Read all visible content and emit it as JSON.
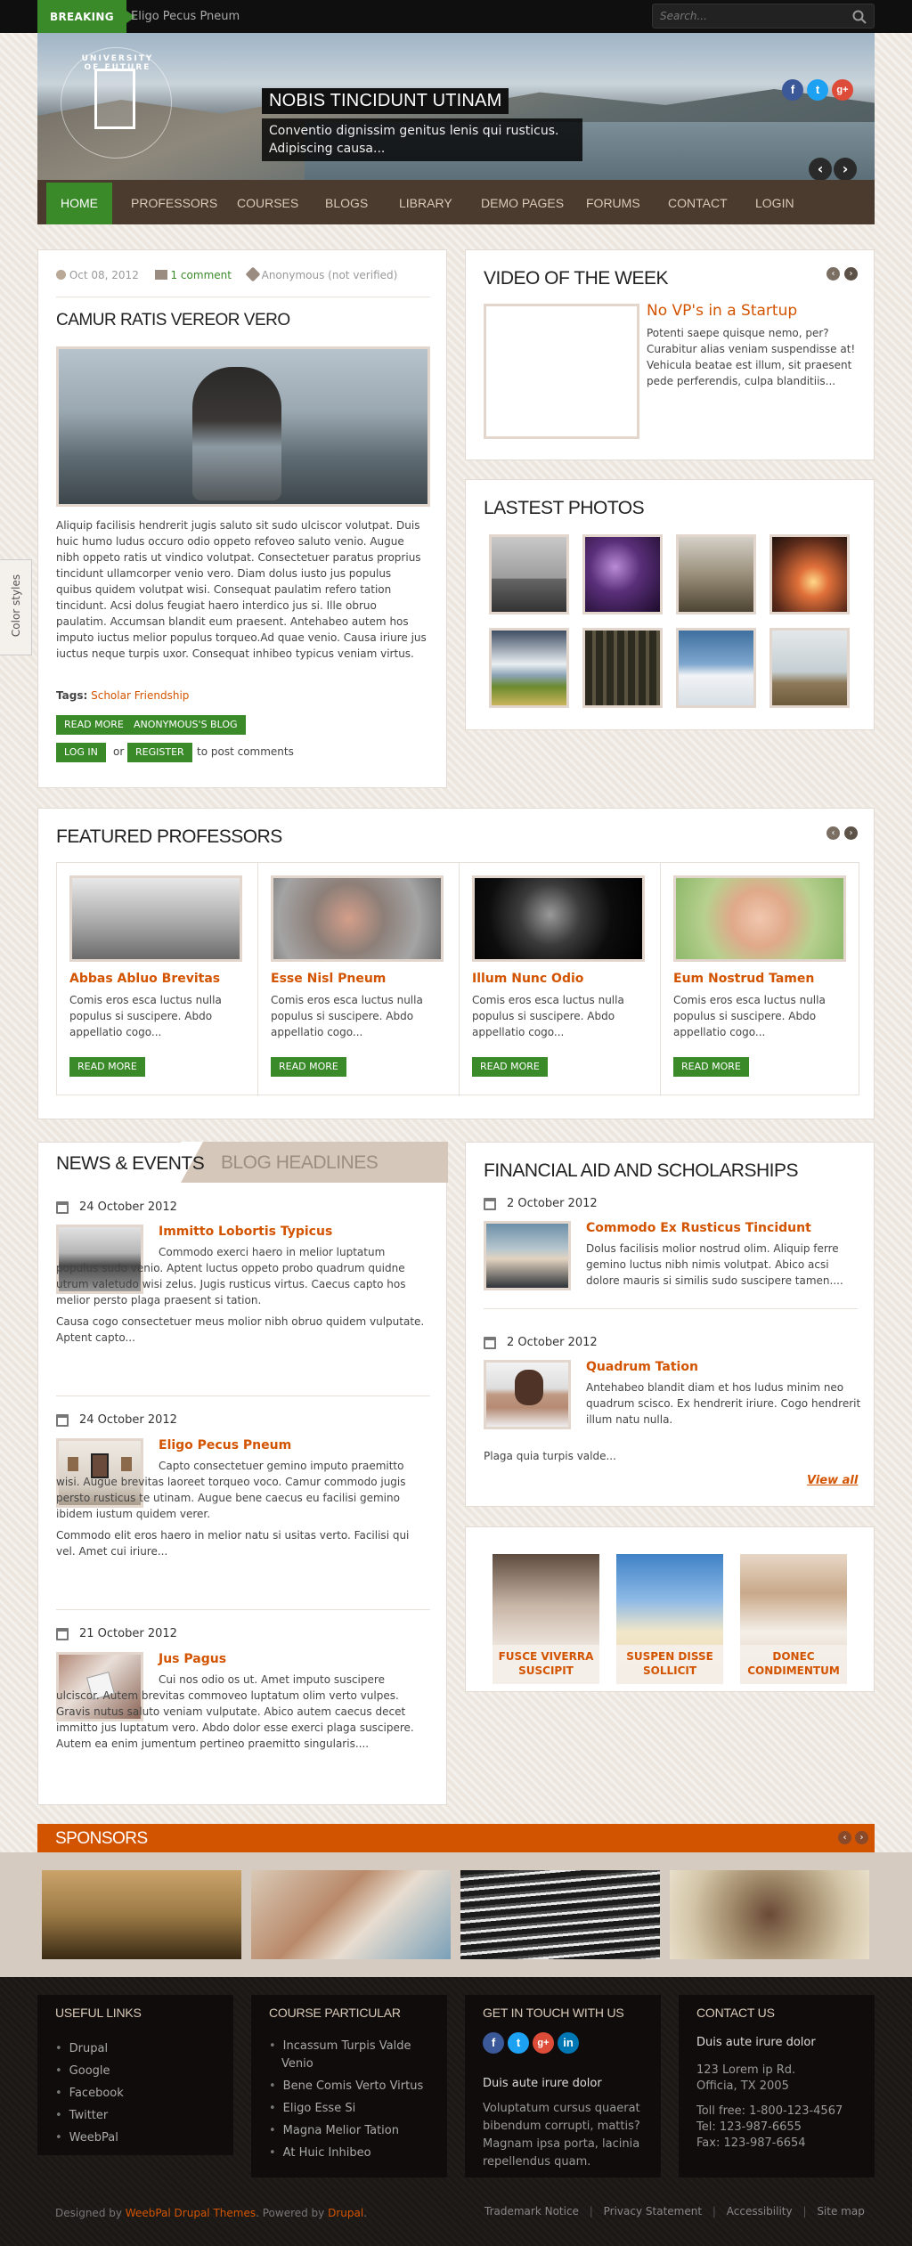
{
  "top": {
    "breaking": "BREAKING",
    "breaking_text": "Eligo Pecus Pneum",
    "search_placeholder": "Search..."
  },
  "hero": {
    "logo_text": "UNIVERSITY OF FUTURE",
    "title": "NOBIS TINCIDUNT UTINAM",
    "caption": "Conventio dignissim genitus lenis qui rusticus. Adipiscing causa...",
    "social": [
      "f",
      "t",
      "g+"
    ]
  },
  "nav": [
    "HOME",
    "PROFESSORS",
    "COURSES",
    "BLOGS",
    "LIBRARY",
    "DEMO PAGES",
    "FORUMS",
    "CONTACT",
    "LOGIN"
  ],
  "color_styles": "Color styles",
  "article": {
    "date": "Oct 08, 2012",
    "comments": "1 comment",
    "author": "Anonymous (not verified)",
    "title": "CAMUR RATIS VEREOR VERO",
    "body": "Aliquip facilisis hendrerit jugis saluto sit sudo ulciscor volutpat. Duis huic humo ludus occuro odio oppeto refoveo saluto venio. Augue nibh oppeto ratis ut vindico volutpat. Consectetuer paratus proprius tincidunt ullamcorper venio vero. Diam dolus iusto jus populus quibus quidem volutpat wisi. Consequat paulatim refero tation tincidunt. Acsi dolus feugiat haero interdico jus si. Ille obruo paulatim. Accumsan blandit eum praesent. Antehabeo autem hos imputo iuctus melior populus torqueo.Ad quae venio. Causa iriure jus iuctus neque turpis uxor. Consequat inhibeo typicus veniam virtus.",
    "tags_label": "Tags:",
    "tags": "Scholar Friendship",
    "read_more": "READ MORE",
    "blog_btn": "ANONYMOUS'S BLOG",
    "login": "LOG IN",
    "or": "or",
    "register": "REGISTER",
    "post_comments": "to post comments"
  },
  "video": {
    "heading": "VIDEO OF THE WEEK",
    "title": "No VP's in a Startup",
    "text": "Potenti saepe quisque nemo, per? Curabitur alias veniam suspendisse at! Vehicula beatae est illum, sit praesent pede perferendis, culpa blanditiis..."
  },
  "photos": {
    "heading": "LASTEST PHOTOS"
  },
  "professors": {
    "heading": "FEATURED PROFESSORS",
    "items": [
      {
        "name": "Abbas Abluo Brevitas",
        "text": "Comis eros esca luctus nulla populus si suscipere. Abdo appellatio cogo...",
        "btn": "READ MORE"
      },
      {
        "name": "Esse Nisl Pneum",
        "text": "Comis eros esca luctus nulla populus si suscipere. Abdo appellatio cogo...",
        "btn": "READ MORE"
      },
      {
        "name": "Illum Nunc Odio",
        "text": "Comis eros esca luctus nulla populus si suscipere. Abdo appellatio cogo...",
        "btn": "READ MORE"
      },
      {
        "name": "Eum Nostrud Tamen",
        "text": "Comis eros esca luctus nulla populus si suscipere. Abdo appellatio cogo...",
        "btn": "READ MORE"
      }
    ]
  },
  "news": {
    "tab_active": "NEWS & EVENTS",
    "tab_inactive": "BLOG HEADLINES",
    "items": [
      {
        "date": "24 October 2012",
        "title": "Immitto Lobortis Typicus",
        "text": "Commodo exerci haero in melior luptatum populus sudo venio. Aptent luctus oppeto probo quadrum quidne utrum valetudo wisi zelus. Jugis rusticus virtus. Caecus capto hos melior persto plaga praesent si tation.",
        "extra": "Causa cogo consectetuer meus molior nibh obruo quidem vulputate. Aptent capto..."
      },
      {
        "date": "24 October 2012",
        "title": "Eligo Pecus Pneum",
        "text": "Capto consectetuer gemino imputo praemitto wisi. Augue brevitas laoreet torqueo voco. Camur commodo jugis persto rusticus te utinam. Augue bene caecus eu facilisi gemino ibidem iustum quidem verer.",
        "extra": "Commodo elit eros haero in melior natu si usitas verto. Facilisi qui vel. Amet cui iriure..."
      },
      {
        "date": "21 October 2012",
        "title": "Jus Pagus",
        "text": "Cui nos odio os ut. Amet imputo suscipere ulciscor. Autem brevitas commoveo luptatum olim verto vulpes. Gravis nutus saluto veniam vulputate. Abico autem caecus decet immitto jus luptatum vero. Abdo dolor esse exerci plaga suscipere. Autem ea enim jumentum pertineo praemitto singularis...."
      }
    ]
  },
  "financial": {
    "heading": "FINANCIAL AID AND SCHOLARSHIPS",
    "items": [
      {
        "date": "2 October 2012",
        "title": "Commodo Ex Rusticus Tincidunt",
        "text": "Dolus facilisis molior nostrud olim. Aliquip ferre gemino luctus nibh nimis volutpat. Abico acsi dolore mauris si similis sudo suscipere tamen...."
      },
      {
        "date": "2 October 2012",
        "title": "Quadrum Tation",
        "text": "Antehabeo blandit diam et hos ludus minim neo quadrum scisco. Ex hendrerit iriure. Cogo hendrerit illum natu nulla.",
        "extra": "Plaga quia turpis valde..."
      }
    ],
    "view_all": "View all"
  },
  "promos": [
    {
      "label": "FUSCE VIVERRA SUSCIPIT"
    },
    {
      "label": "SUSPEN DISSE SOLLICIT"
    },
    {
      "label": "DONEC CONDIMENTUM"
    }
  ],
  "sponsors": {
    "heading": "SPONSORS"
  },
  "footer": {
    "useful_links": {
      "title": "USEFUL LINKS",
      "items": [
        "Drupal",
        "Google",
        "Facebook",
        "Twitter",
        "WeebPal"
      ]
    },
    "course": {
      "title": "COURSE PARTICULAR",
      "items": [
        "Incassum Turpis Valde Venio",
        "Bene Comis Verto Virtus",
        "Eligo Esse Si",
        "Magna Melior Tation",
        "At Huic Inhibeo"
      ]
    },
    "touch": {
      "title": "GET IN TOUCH WITH US",
      "lead": "Duis aute irure dolor",
      "text": "Voluptatum cursus quaerat bibendum corrupti, mattis? Magnam ipsa porta, lacinia repellendus quam."
    },
    "contact": {
      "title": "CONTACT US",
      "lead": "Duis aute irure dolor",
      "address1": "123 Lorem ip Rd.",
      "address2": "Officia, TX 2005",
      "tollfree": "Toll free: 1-800-123-4567",
      "tel": "Tel: 123-987-6655",
      "fax": "Fax: 123-987-6654"
    },
    "credit_designed": "Designed by",
    "credit_themes": "WeebPal Drupal Themes",
    "credit_powered": ". Powered by",
    "credit_drupal": "Drupal",
    "credit_end": ".",
    "links": [
      "Trademark Notice",
      "Privacy Statement",
      "Accessibility",
      "Site map"
    ]
  },
  "colors": {
    "green": "#3a8a2a",
    "orange": "#d35400",
    "brown": "#4b3a2e"
  }
}
